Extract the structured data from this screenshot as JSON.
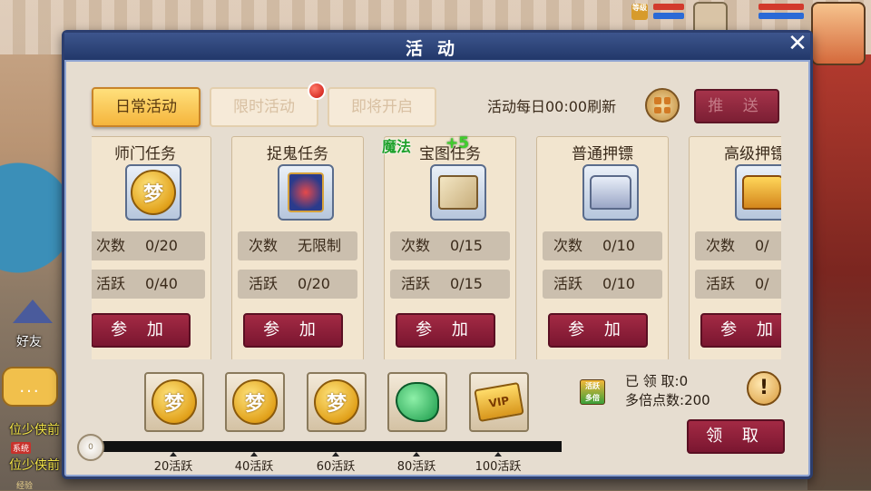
{
  "panel": {
    "title": "活动",
    "close_icon": "close-icon"
  },
  "tabs": [
    {
      "label": "日常活动",
      "active": true
    },
    {
      "label": "限时活动",
      "active": false,
      "has_notification_dot": true
    },
    {
      "label": "即将开启",
      "active": false
    }
  ],
  "refresh_text": "活动每日00:00刷新",
  "push_button": "推 送",
  "float_text": {
    "label": "魔法",
    "value": "+5"
  },
  "activities": [
    {
      "name": "师门任务",
      "icon": "gold-coin-icon",
      "count_label": "次数",
      "count": "0/20",
      "active_label": "活跃",
      "active": "0/40",
      "button": "参 加",
      "new_ribbon": true
    },
    {
      "name": "捉鬼任务",
      "icon": "demon-mask-icon",
      "count_label": "次数",
      "count": "无限制",
      "active_label": "活跃",
      "active": "0/20",
      "button": "参 加"
    },
    {
      "name": "宝图任务",
      "icon": "treasure-map-icon",
      "count_label": "次数",
      "count": "0/15",
      "active_label": "活跃",
      "active": "0/15",
      "button": "参 加"
    },
    {
      "name": "普通押镖",
      "icon": "silver-chest-icon",
      "count_label": "次数",
      "count": "0/10",
      "active_label": "活跃",
      "active": "0/10",
      "button": "参 加"
    },
    {
      "name": "高级押镖",
      "icon": "gold-chest-icon",
      "count_label": "次数",
      "count": "0/",
      "active_label": "活跃",
      "active": "0/",
      "button": "参 加"
    }
  ],
  "rewards": [
    {
      "icon": "gold-coin-icon",
      "label": "20活跃",
      "glyph": "梦"
    },
    {
      "icon": "gold-coin-icon",
      "label": "40活跃",
      "glyph": "梦"
    },
    {
      "icon": "gold-coin-icon",
      "label": "60活跃",
      "glyph": "梦"
    },
    {
      "icon": "jade-icon",
      "label": "80活跃"
    },
    {
      "icon": "vip-card-icon",
      "label": "100活跃",
      "glyph": "VIP"
    }
  ],
  "progress": {
    "current": 0,
    "knob_label": "0",
    "max": 100
  },
  "points": {
    "claimed_label": "已 领 取:",
    "claimed_value": "0",
    "multi_label": "多倍点数:",
    "multi_value": "200",
    "icon_text": "活跃",
    "icon_label": "多倍"
  },
  "claim_button": "领 取",
  "info_icon": "!",
  "side": {
    "friend_label": "好友",
    "chat_icon": "...",
    "chat_lines": [
      "位少侠前",
      "位少侠前"
    ],
    "system_badge": "系统",
    "exp_label": "经验"
  },
  "hud": {
    "level_badge": "等级"
  },
  "colors": {
    "panel_border": "#2c3e6e",
    "active_tab": "#f5b53c",
    "action_button": "#7a1630",
    "progress_track": "#111111"
  }
}
